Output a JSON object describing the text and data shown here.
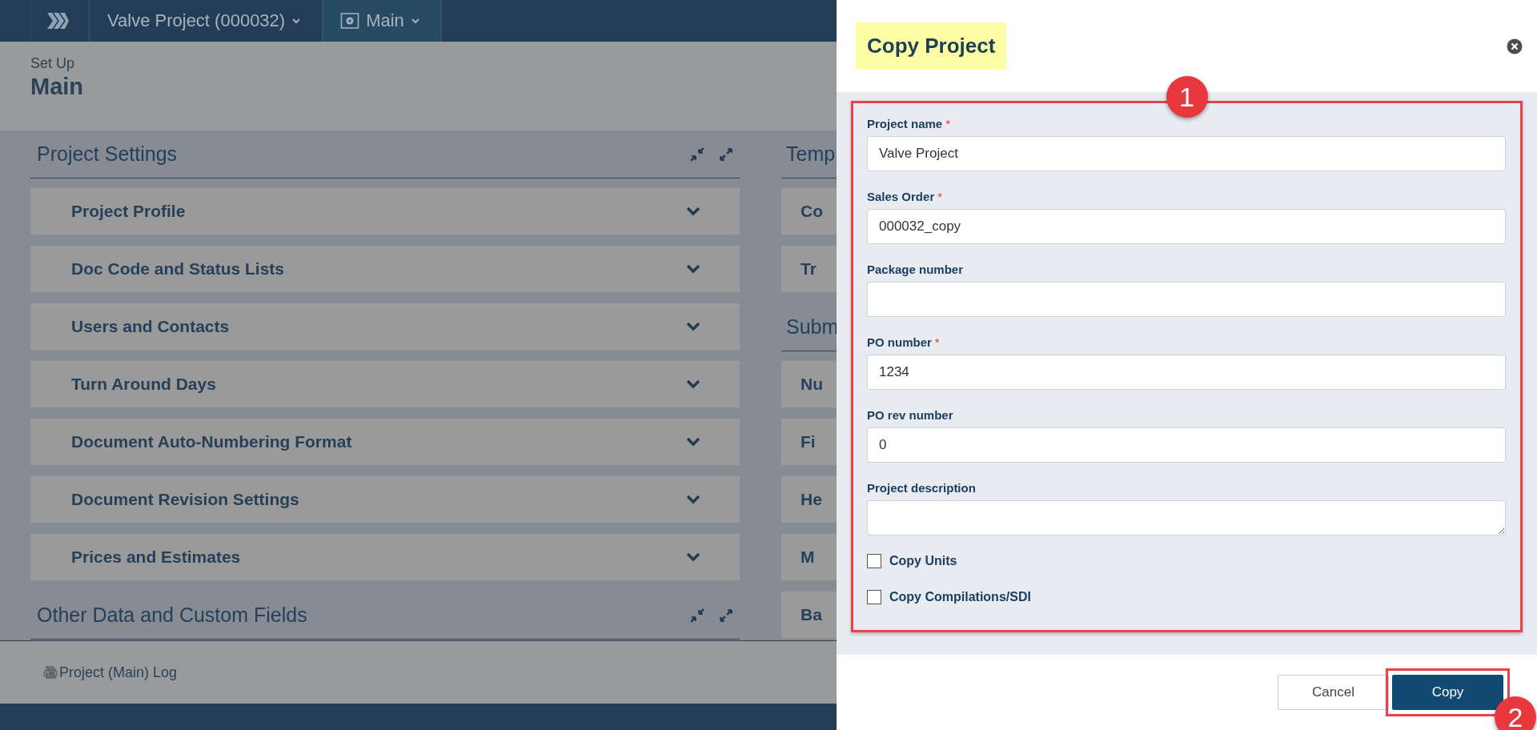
{
  "topbar": {
    "crumbs": [
      {
        "label": "Valve Project (000032)",
        "kind": "project",
        "selected": false
      },
      {
        "label": "Main",
        "kind": "module",
        "selected": true
      }
    ]
  },
  "page_header": {
    "subtitle": "Set Up",
    "title": "Main"
  },
  "columns": [
    [
      {
        "title": "Project Settings",
        "tools": true,
        "items": [
          {
            "label": "Project Profile",
            "expanded": false
          },
          {
            "label": "Doc Code and Status Lists",
            "expanded": false
          },
          {
            "label": "Users and Contacts",
            "expanded": false
          },
          {
            "label": "Turn Around Days",
            "expanded": false
          },
          {
            "label": "Document Auto-Numbering Format",
            "expanded": false
          },
          {
            "label": "Document Revision Settings",
            "expanded": false
          },
          {
            "label": "Prices and Estimates",
            "expanded": false
          }
        ]
      },
      {
        "title": "Other Data and Custom Fields",
        "tools": true
      }
    ],
    [
      {
        "title": "Temp",
        "tools": false,
        "items": [
          {
            "label": "Co"
          },
          {
            "label": "Tr"
          }
        ]
      },
      {
        "title": "Subm",
        "tools": false,
        "items": [
          {
            "label": "Nu"
          },
          {
            "label": "Fi"
          },
          {
            "label": "He"
          },
          {
            "label": "M"
          },
          {
            "label": "Ba"
          }
        ]
      }
    ]
  ],
  "footer": {
    "log_link": "Project (Main) Log"
  },
  "dialog": {
    "title": "Copy Project",
    "fields": [
      {
        "label": "Project name",
        "required_mark": "*",
        "kind": "text",
        "value": "Valve Project"
      },
      {
        "label": "Sales Order",
        "required_mark": "*",
        "kind": "text",
        "value": "000032_copy"
      },
      {
        "label": "Package number",
        "kind": "text"
      },
      {
        "label": "PO number",
        "required_mark": "*",
        "kind": "text",
        "value": "1234"
      },
      {
        "label": "PO rev number",
        "kind": "text",
        "value": "0"
      },
      {
        "label": "Project description",
        "kind": "textarea"
      }
    ],
    "checkboxes": [
      {
        "label": "Copy Units",
        "checked": false
      },
      {
        "label": "Copy Compilations/SDI",
        "checked": false
      }
    ],
    "buttons": [
      {
        "label": "Cancel",
        "kind": "secondary"
      },
      {
        "label": "Copy",
        "kind": "primary"
      }
    ]
  },
  "annotations": [
    {
      "label": "1",
      "kind": "form"
    },
    {
      "label": "2",
      "kind": "button"
    }
  ]
}
